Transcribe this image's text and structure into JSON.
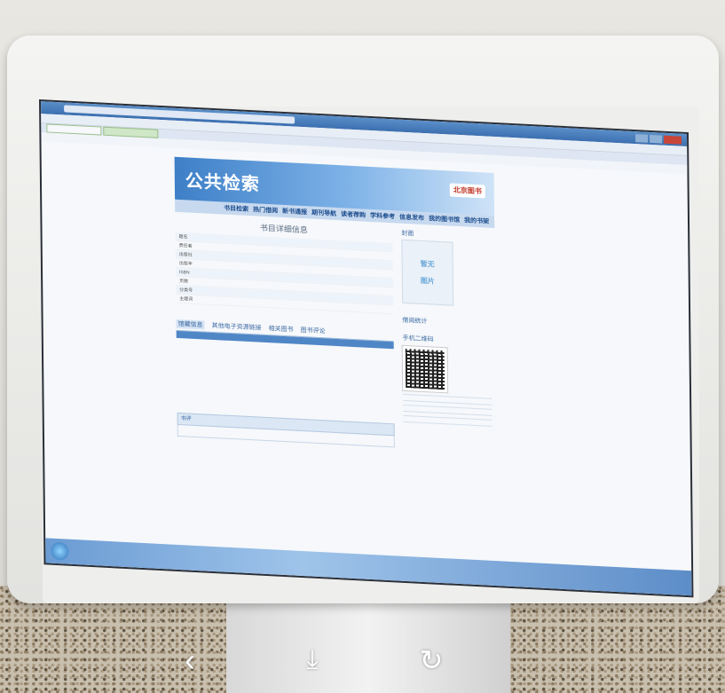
{
  "page": {
    "banner_title": "公共检索",
    "logo_text": "北京图书",
    "nav_items": [
      "书目检索",
      "热门借阅",
      "新书通报",
      "期刊导航",
      "读者荐购",
      "学科参考",
      "信息发布",
      "我的图书馆",
      "我的书架"
    ],
    "detail_title": "书目详细信息",
    "fields": [
      {
        "key": "题名"
      },
      {
        "key": "责任者"
      },
      {
        "key": "出版社"
      },
      {
        "key": "出版年"
      },
      {
        "key": "ISBN"
      },
      {
        "key": "页数"
      },
      {
        "key": "分类号"
      },
      {
        "key": "主题词"
      }
    ],
    "holding_tabs": [
      "馆藏信息",
      "其他电子资源链接",
      "相关图书",
      "图书评论"
    ],
    "review_label": "书评",
    "side": {
      "cover_label": "封面",
      "cover_text_1": "暂无",
      "cover_text_2": "图片",
      "stats_title": "借阅统计",
      "qr_title": "手机二维码"
    }
  },
  "colors": {
    "banner": "#3d7fc7",
    "nav_bg": "#c7d9ef",
    "taskbar": "#6a9bd3"
  },
  "overlay": {
    "back_icon": "chevron-left-icon",
    "download_icon": "download-icon",
    "rotate_icon": "rotate-icon"
  }
}
